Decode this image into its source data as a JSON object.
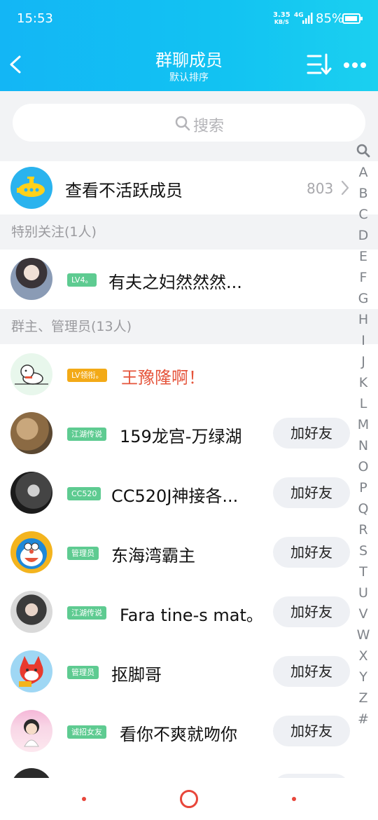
{
  "status_bar": {
    "time": "15:53",
    "net_speed_value": "3.35",
    "net_speed_unit": "KB/S",
    "network": "4G",
    "battery": "85%"
  },
  "header": {
    "title": "群聊成员",
    "subtitle": "默认排序",
    "back_icon": "chevron-left-icon",
    "sort_icon": "sort-icon",
    "more_icon": "more-dots-icon"
  },
  "search": {
    "placeholder": "搜索"
  },
  "inactive": {
    "label": "查看不活跃成员",
    "count": "803"
  },
  "sections": {
    "special": "特别关注(1人)",
    "admins": "群主、管理员(13人)"
  },
  "special_members": [
    {
      "badge": "LV4。",
      "badge_color": "#5ecb91",
      "name": "有夫之妇然然然...",
      "name_color": "#111111"
    }
  ],
  "admin_members": [
    {
      "badge": "LV领衔。",
      "badge_color": "#f3aa17",
      "name": "王豫隆啊！",
      "name_color": "#e5543b",
      "add": ""
    },
    {
      "badge": "江湖传说",
      "badge_color": "#5ecb91",
      "name": "159龙宫-万绿湖",
      "name_color": "#111111",
      "add": "加好友"
    },
    {
      "badge": "CC520",
      "badge_color": "#5ecb91",
      "name": "CC520J神接各...",
      "name_color": "#111111",
      "add": "加好友"
    },
    {
      "badge": "管理员",
      "badge_color": "#5ecb91",
      "name": "东海湾霸主",
      "name_color": "#111111",
      "add": "加好友"
    },
    {
      "badge": "江湖传说",
      "badge_color": "#5ecb91",
      "name": "Fara tine-s mat。",
      "name_color": "#111111",
      "add": "加好友"
    },
    {
      "badge": "管理员",
      "badge_color": "#5ecb91",
      "name": "抠脚哥",
      "name_color": "#111111",
      "add": "加好友"
    },
    {
      "badge": "诚招女友",
      "badge_color": "#5ecb91",
      "name": "看你不爽就吻你",
      "name_color": "#111111",
      "add": "加好友"
    }
  ],
  "alpha_index": [
    "A",
    "B",
    "C",
    "D",
    "E",
    "F",
    "G",
    "H",
    "I",
    "J",
    "K",
    "L",
    "M",
    "N",
    "O",
    "P",
    "Q",
    "R",
    "S",
    "T",
    "U",
    "V",
    "W",
    "X",
    "Y",
    "Z",
    "#"
  ],
  "colors": {
    "header_start": "#13b6f5",
    "header_end": "#1bd0f0",
    "accent_red": "#e8463a",
    "badge_green": "#5ecb91",
    "badge_orange": "#f3aa17"
  }
}
